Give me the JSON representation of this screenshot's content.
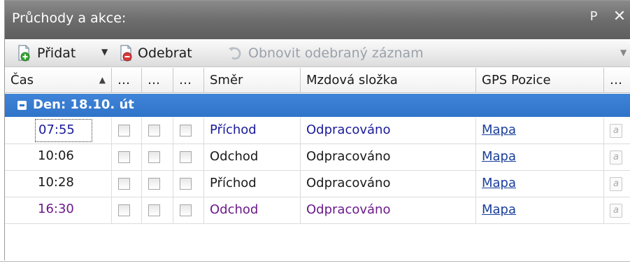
{
  "panel": {
    "title": "Průchody a akce:",
    "pin_glyph": "Ρ",
    "close_glyph": "✕"
  },
  "toolbar": {
    "add_label": "Přidat",
    "remove_label": "Odebrat",
    "restore_label": "Obnovit odebraný záznam"
  },
  "grid": {
    "headers": {
      "time": "Čas",
      "flag1": "…",
      "flag2": "…",
      "flag3": "…",
      "direction": "Směr",
      "wage": "Mzdová složka",
      "gps": "GPS Pozice",
      "more": "…"
    },
    "group": {
      "label": "Den: 18.10. út"
    },
    "rows": [
      {
        "time": "07:55",
        "direction": "Příchod",
        "wage": "Odpracováno",
        "gps": "Mapa"
      },
      {
        "time": "10:06",
        "direction": "Odchod",
        "wage": "Odpracováno",
        "gps": "Mapa"
      },
      {
        "time": "10:28",
        "direction": "Příchod",
        "wage": "Odpracováno",
        "gps": "Mapa"
      },
      {
        "time": "16:30",
        "direction": "Odchod",
        "wage": "Odpracováno",
        "gps": "Mapa"
      }
    ],
    "row_icon_text": "a"
  },
  "colors": {
    "group_bar": "#2f74c9",
    "link": "#1a3e9a",
    "purple_text": "#6b1a8a",
    "navy_text": "#1a1a9a"
  }
}
